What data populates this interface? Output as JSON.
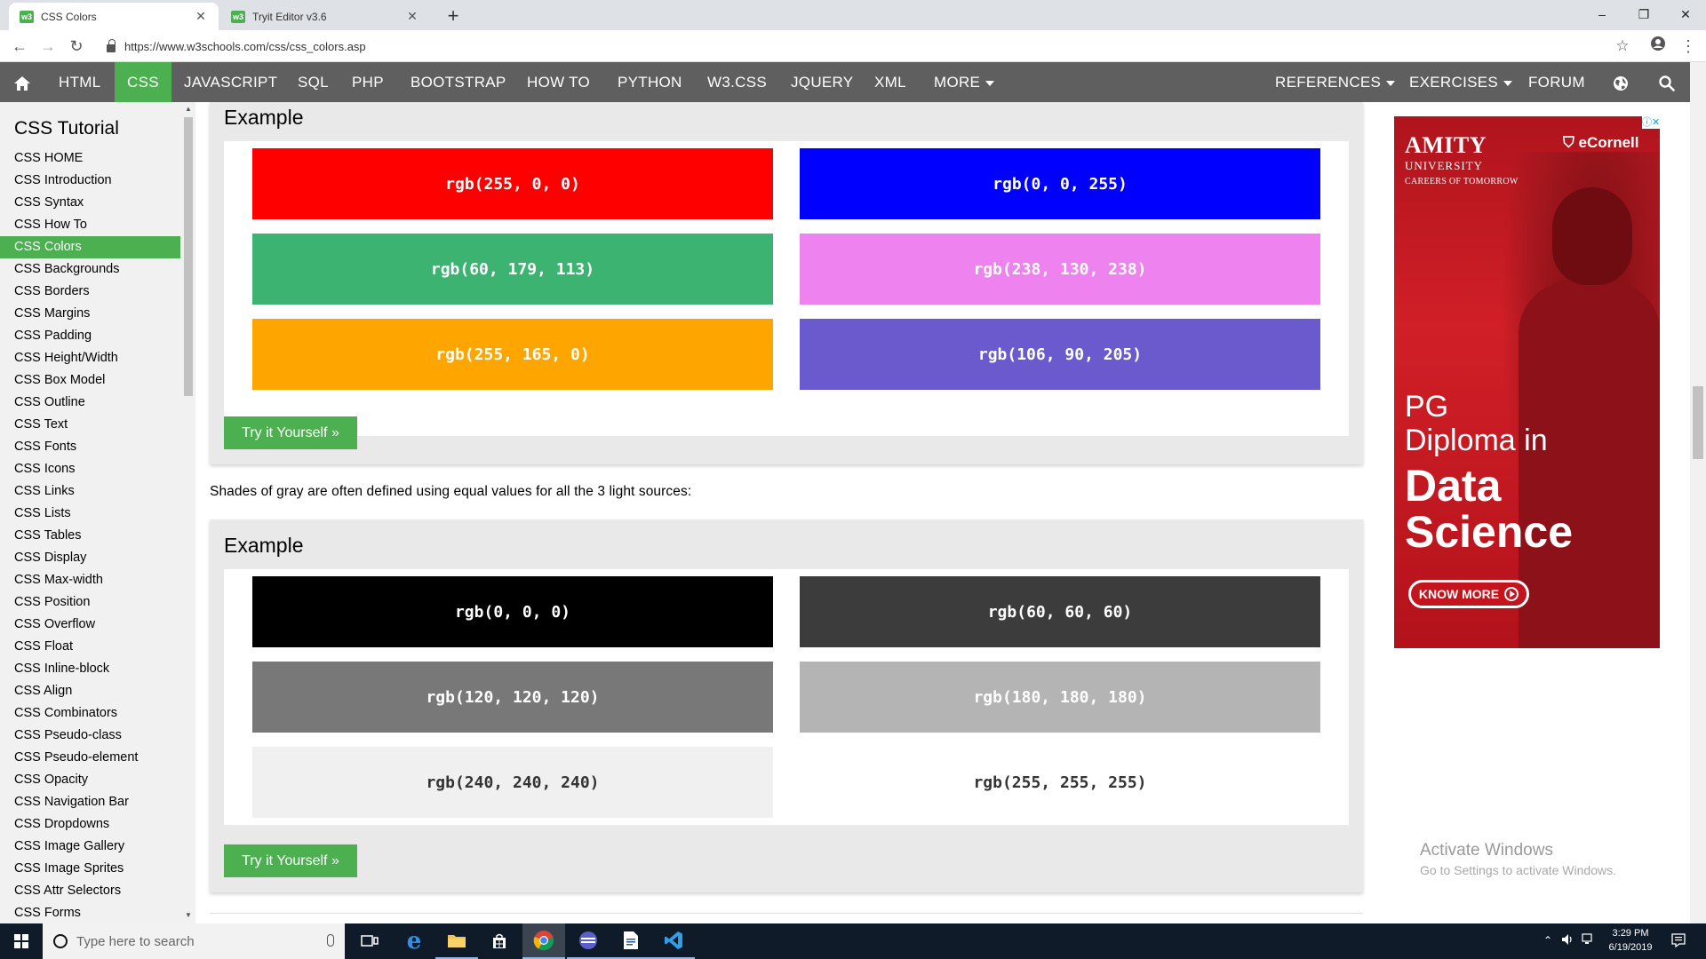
{
  "browser": {
    "tabs": [
      {
        "title": "CSS Colors",
        "favicon": "w3"
      },
      {
        "title": "Tryit Editor v3.6",
        "favicon": "w3"
      }
    ],
    "url": "https://www.w3schools.com/css/css_colors.asp",
    "window_controls": {
      "minimize": "–",
      "maximize": "❐",
      "close": "✕"
    }
  },
  "topnav": {
    "items": [
      "HTML",
      "CSS",
      "JAVASCRIPT",
      "SQL",
      "PHP",
      "BOOTSTRAP",
      "HOW TO",
      "PYTHON",
      "W3.CSS",
      "JQUERY",
      "XML",
      "MORE"
    ],
    "active": "CSS",
    "right_items": [
      "REFERENCES",
      "EXERCISES",
      "FORUM"
    ]
  },
  "sidebar": {
    "title": "CSS Tutorial",
    "items": [
      "CSS HOME",
      "CSS Introduction",
      "CSS Syntax",
      "CSS How To",
      "CSS Colors",
      "CSS Backgrounds",
      "CSS Borders",
      "CSS Margins",
      "CSS Padding",
      "CSS Height/Width",
      "CSS Box Model",
      "CSS Outline",
      "CSS Text",
      "CSS Fonts",
      "CSS Icons",
      "CSS Links",
      "CSS Lists",
      "CSS Tables",
      "CSS Display",
      "CSS Max-width",
      "CSS Position",
      "CSS Overflow",
      "CSS Float",
      "CSS Inline-block",
      "CSS Align",
      "CSS Combinators",
      "CSS Pseudo-class",
      "CSS Pseudo-element",
      "CSS Opacity",
      "CSS Navigation Bar",
      "CSS Dropdowns",
      "CSS Image Gallery",
      "CSS Image Sprites",
      "CSS Attr Selectors",
      "CSS Forms"
    ],
    "active": "CSS Colors"
  },
  "main": {
    "example1": {
      "title": "Example",
      "swatches": [
        {
          "label": "rgb(255, 0, 0)",
          "bg": "#ff0000",
          "fg": "#ffffff"
        },
        {
          "label": "rgb(0, 0, 255)",
          "bg": "#0000ff",
          "fg": "#ffffff"
        },
        {
          "label": "rgb(60, 179, 113)",
          "bg": "#3cb371",
          "fg": "#ffffff"
        },
        {
          "label": "rgb(238, 130, 238)",
          "bg": "#ee82ee",
          "fg": "#ffffff"
        },
        {
          "label": "rgb(255, 165, 0)",
          "bg": "#ffa500",
          "fg": "#ffffff"
        },
        {
          "label": "rgb(106, 90, 205)",
          "bg": "#6a5acd",
          "fg": "#ffffff"
        }
      ],
      "button": "Try it Yourself »"
    },
    "shades_text": "Shades of gray are often defined using equal values for all the 3 light sources:",
    "example2": {
      "title": "Example",
      "swatches": [
        {
          "label": "rgb(0, 0, 0)",
          "bg": "#000000",
          "fg": "#ffffff"
        },
        {
          "label": "rgb(60, 60, 60)",
          "bg": "#3c3c3c",
          "fg": "#ffffff"
        },
        {
          "label": "rgb(120, 120, 120)",
          "bg": "#787878",
          "fg": "#ffffff"
        },
        {
          "label": "rgb(180, 180, 180)",
          "bg": "#b4b4b4",
          "fg": "#ffffff"
        },
        {
          "label": "rgb(240, 240, 240)",
          "bg": "#f0f0f0",
          "fg": "#333333"
        },
        {
          "label": "rgb(255, 255, 255)",
          "bg": "#ffffff",
          "fg": "#333333"
        }
      ],
      "button": "Try it Yourself »"
    }
  },
  "ad": {
    "amity_name": "AMITY",
    "amity_university": "UNIVERSITY",
    "amity_tagline": "CAREERS OF TOMORROW",
    "ecornell": "eCornell",
    "headline_1": "PG",
    "headline_2": "Diploma in",
    "headline_3": "Data",
    "headline_4": "Science",
    "cta": "KNOW MORE"
  },
  "watermark": {
    "title": "Activate Windows",
    "subtitle": "Go to Settings to activate Windows."
  },
  "taskbar": {
    "search_placeholder": "Type here to search",
    "time": "3:29 PM",
    "date": "6/19/2019"
  },
  "colors": {
    "nav_bg": "#5f5f5f",
    "accent": "#4caf50",
    "example_bg": "#e9e9e9",
    "taskbar_bg": "#101b29"
  }
}
